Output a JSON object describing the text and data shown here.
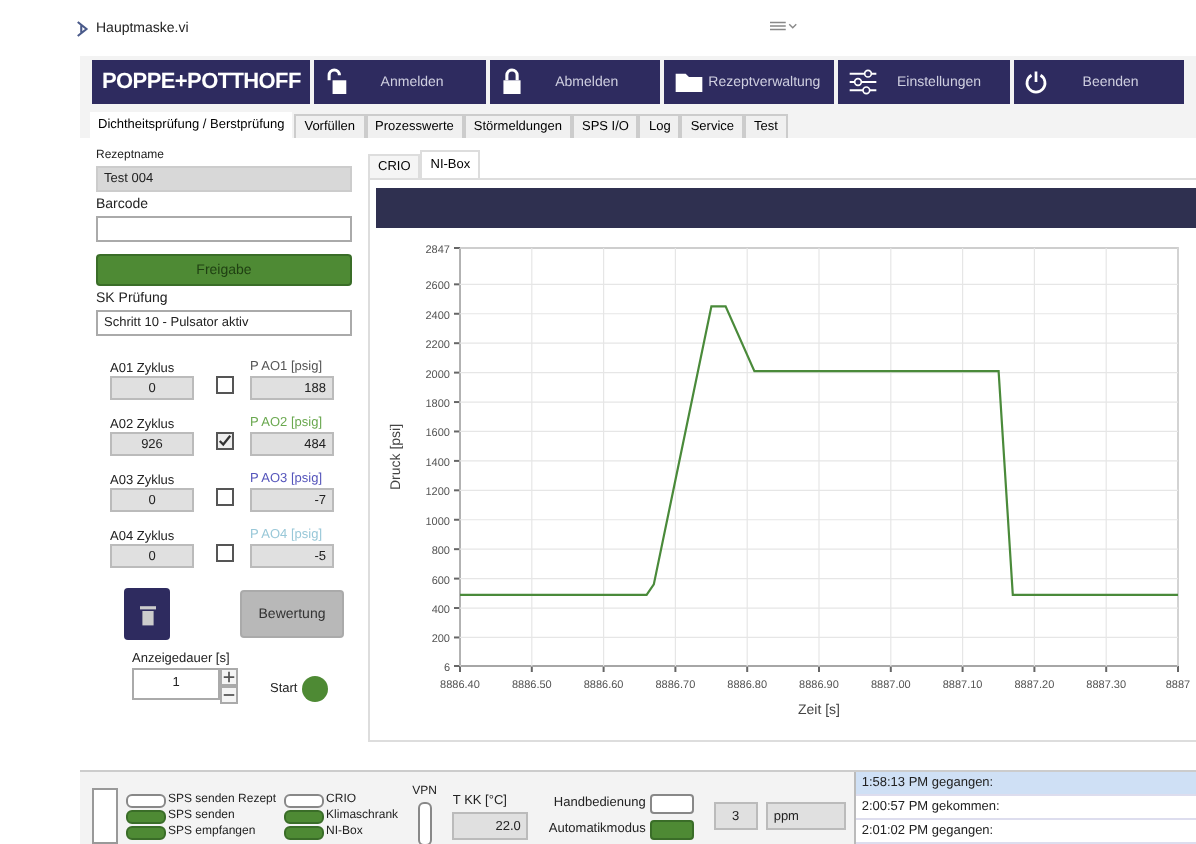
{
  "window": {
    "title": "Hauptmaske.vi"
  },
  "toolbar": {
    "logo": "POPPE+POTTHOFF",
    "buttons": [
      {
        "label": "Anmelden",
        "kind": "unlock"
      },
      {
        "label": "Abmelden",
        "kind": "lock"
      },
      {
        "label": "Rezeptverwaltung",
        "kind": "folder"
      },
      {
        "label": "Einstellungen",
        "kind": "sliders"
      },
      {
        "label": "Beenden",
        "kind": "power"
      }
    ]
  },
  "tabs": [
    {
      "label": "Dichtheitsprüfung / Berstprüfung",
      "selected": true
    },
    {
      "label": "Vorfüllen",
      "selected": false
    },
    {
      "label": "Prozesswerte",
      "selected": false
    },
    {
      "label": "Störmeldungen",
      "selected": false
    },
    {
      "label": "SPS I/O",
      "selected": false
    },
    {
      "label": "Log",
      "selected": false
    },
    {
      "label": "Service",
      "selected": false
    },
    {
      "label": "Test",
      "selected": false
    }
  ],
  "recipe": {
    "name_label": "Rezeptname",
    "name": "Test 004",
    "barcode_label": "Barcode",
    "release_button": "Freigabe",
    "step_label": "SK Prüfung",
    "step": "Schritt 10 - Pulsator aktiv"
  },
  "channels": [
    {
      "cycle_label": "A01 Zyklus",
      "cycles": "0",
      "checked": false,
      "pressure_label": "P AO1 [psig]",
      "color": "#555555",
      "pressure": "188"
    },
    {
      "cycle_label": "A02 Zyklus",
      "cycles": "926",
      "checked": true,
      "pressure_label": "P AO2 [psig]",
      "color": "#6aa84f",
      "pressure": "484"
    },
    {
      "cycle_label": "A03 Zyklus",
      "cycles": "0",
      "checked": false,
      "pressure_label": "P AO3 [psig]",
      "color": "#5555bb",
      "pressure": "-7"
    },
    {
      "cycle_label": "A04 Zyklus",
      "cycles": "0",
      "checked": false,
      "pressure_label": "P AO4 [psig]",
      "color": "#99c8d8",
      "pressure": "-5"
    }
  ],
  "evaluate_button": "Bewertung",
  "duration": {
    "label": "Anzeigedauer [s]",
    "value": "1"
  },
  "start": {
    "label": "Start",
    "on": true
  },
  "graph_tabs": [
    {
      "label": "CRIO",
      "selected": false
    },
    {
      "label": "NI-Box",
      "selected": true
    }
  ],
  "chart_data": {
    "type": "line",
    "xlabel": "Zeit [s]",
    "ylabel": "Druck [psi]",
    "x": [
      8886.4,
      8886.66,
      8886.67,
      8886.75,
      8886.77,
      8886.81,
      8887.15,
      8887.17,
      8887.4
    ],
    "series": [
      {
        "color": "#4a8a3a",
        "values": [
          490,
          490,
          560,
          2450,
          2450,
          2010,
          2010,
          490,
          490
        ]
      }
    ],
    "grid": true,
    "xlim": [
      8886.4,
      8887.4
    ],
    "ylim": [
      6,
      2847
    ],
    "xticks": [
      {
        "value": 8886.4,
        "label": "8886.40"
      },
      {
        "value": 8886.5,
        "label": "8886.50"
      },
      {
        "value": 8886.6,
        "label": "8886.60"
      },
      {
        "value": 8886.7,
        "label": "8886.70"
      },
      {
        "value": 8886.8,
        "label": "8886.80"
      },
      {
        "value": 8886.9,
        "label": "8886.90"
      },
      {
        "value": 8887.0,
        "label": "8887.00"
      },
      {
        "value": 8887.1,
        "label": "8887.10"
      },
      {
        "value": 8887.2,
        "label": "8887.20"
      },
      {
        "value": 8887.3,
        "label": "8887.30"
      },
      {
        "value": 8887.4,
        "label": "8887"
      }
    ],
    "yticks": [
      6,
      200,
      400,
      600,
      800,
      1000,
      1200,
      1400,
      1600,
      1800,
      2000,
      2200,
      2400,
      2600,
      2847
    ]
  },
  "status": {
    "lamp_groups": [
      {
        "lamps": [
          {
            "label": "SPS senden Rezept",
            "on": false
          },
          {
            "label": "SPS senden",
            "on": true
          },
          {
            "label": "SPS empfangen",
            "on": true
          }
        ]
      },
      {
        "lamps": [
          {
            "label": "CRIO",
            "on": false
          },
          {
            "label": "Klimaschrank",
            "on": true
          },
          {
            "label": "NI-Box",
            "on": true
          }
        ]
      }
    ],
    "vpn": {
      "label": "VPN",
      "on": false
    },
    "temperature": {
      "label": "T KK [°C]",
      "value": "22.0"
    },
    "modes": [
      {
        "label": "Handbedienung",
        "on": false
      },
      {
        "label": "Automatikmodus",
        "on": true
      }
    ],
    "count": "3",
    "unit": "ppm",
    "messages": [
      {
        "text": "1:58:13 PM gegangen:",
        "selected": true
      },
      {
        "text": "2:00:57 PM gekommen:",
        "selected": false
      },
      {
        "text": "2:01:02 PM gegangen:",
        "selected": false
      }
    ]
  }
}
